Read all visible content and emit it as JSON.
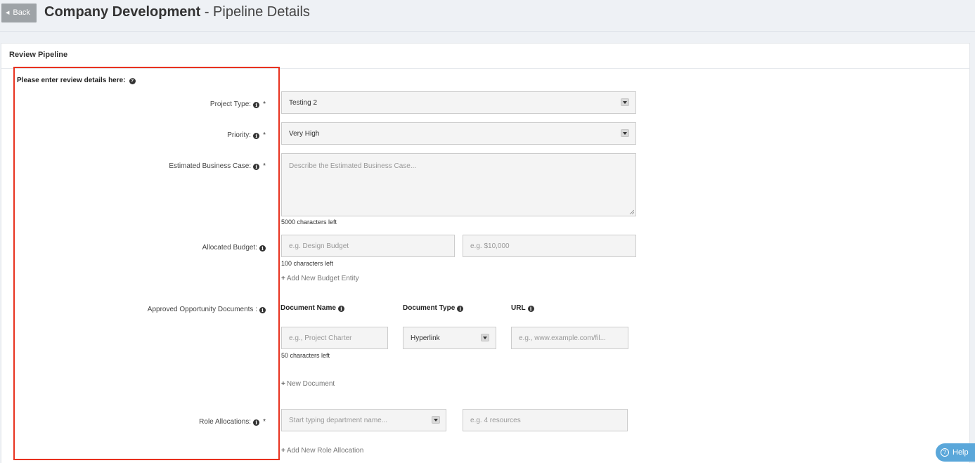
{
  "header": {
    "back_label": "Back",
    "title": "Company Development",
    "subtitle": "- Pipeline Details"
  },
  "panel": {
    "title": "Review Pipeline",
    "intro": "Please enter review details here:"
  },
  "form": {
    "project_type": {
      "label": "Project Type:",
      "value": "Testing 2",
      "required": "*"
    },
    "priority": {
      "label": "Priority:",
      "value": "Very High",
      "required": "*"
    },
    "business_case": {
      "label": "Estimated Business Case:",
      "placeholder": "Describe the Estimated Business Case...",
      "required": "*",
      "counter": "5000 characters left"
    },
    "budget": {
      "label": "Allocated Budget:",
      "name_placeholder": "e.g. Design Budget",
      "amount_placeholder": "e.g. $10,000",
      "counter": "100 characters left",
      "add_label": "Add New Budget Entity"
    },
    "documents": {
      "label": "Approved Opportunity Documents :",
      "col_name": "Document Name",
      "col_type": "Document Type",
      "col_url": "URL",
      "name_placeholder": "e.g., Project Charter",
      "type_value": "Hyperlink",
      "url_placeholder": "e.g., www.example.com/fil...",
      "counter": "50 characters left",
      "add_label": "New Document"
    },
    "roles": {
      "label": "Role Allocations:",
      "required": "*",
      "dept_placeholder": "Start typing department name...",
      "resources_placeholder": "e.g. 4 resources",
      "add_label": "Add New Role Allocation"
    }
  },
  "help": {
    "label": "Help"
  },
  "colors": {
    "highlight": "#e8321f",
    "help_button": "#5aa7da",
    "back_button": "#9ea3a7"
  }
}
